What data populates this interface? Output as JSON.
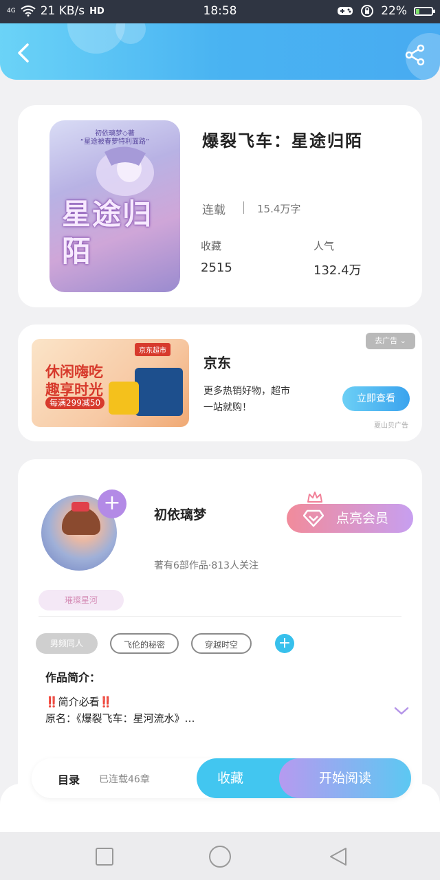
{
  "status_bar": {
    "network": "4G",
    "speed": "21 KB/s",
    "hd": "HD",
    "time": "18:58",
    "battery": "22%"
  },
  "header": {
    "back_icon": "back-arrow-icon",
    "share_icon": "share-icon"
  },
  "book": {
    "cover_top_line1": "初依璃梦◇著",
    "cover_top_line2": "“星途被春萝特利面路”",
    "cover_big_text": "星途归陌",
    "title": "爆裂飞车：星途归陌",
    "status": "连载",
    "word_count": "15.4万字",
    "favorites_label": "收藏",
    "favorites_value": "2515",
    "popularity_label": "人气",
    "popularity_value": "132.4万"
  },
  "ad": {
    "image_headline1": "休闲嗨吃",
    "image_headline2": "趣享时光",
    "image_promo": "每满299减50",
    "image_store": "京东超市",
    "remove_label": "去广告",
    "advertiser": "京东",
    "desc_line1": "更多热销好物，超市",
    "desc_line2": "一站就购！",
    "button": "立即查看",
    "source": "夏山贝广告"
  },
  "author": {
    "name": "初依璃梦",
    "vip_button": "点亮会员",
    "stats": "著有6部作品·813人关注",
    "tag": "璀璨星河",
    "book_tags": [
      "男频同人",
      "飞伦的秘密",
      "穿越时空"
    ],
    "intro_title": "作品简介：",
    "intro_line1": "‼️简介必看‼️",
    "intro_line2": "原名：《爆裂飞车：星河流水》…"
  },
  "bottom_bar": {
    "catalog": "目录",
    "chapters": "已连载46章",
    "collect": "收藏",
    "read": "开始阅读"
  },
  "colors": {
    "header_start": "#6bd3f7",
    "header_end": "#48abf1",
    "accent_blue": "#42c6f0",
    "vip_pink": "#f18b9b",
    "vip_purple": "#c79ff0"
  }
}
